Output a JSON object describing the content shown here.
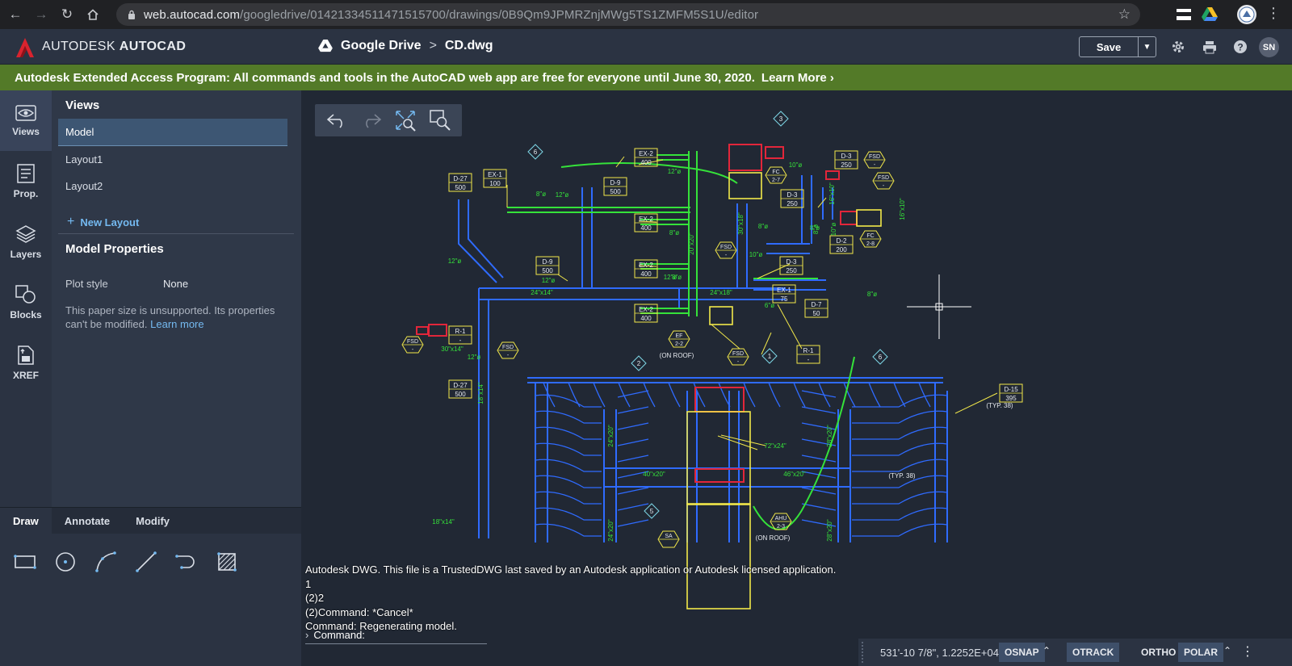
{
  "browser": {
    "url_host": "web.autocad.com",
    "url_path": "/googledrive/01421334511471515700/drawings/0B9Qm9JPMRZnjMWg5TS1ZMFM5S1U/editor"
  },
  "header": {
    "brand_light": "AUTODESK",
    "brand_bold": "AUTOCAD",
    "crumb_root": "Google Drive",
    "crumb_sep": ">",
    "crumb_file": "CD.dwg",
    "save_label": "Save",
    "avatar_initials": "SN"
  },
  "banner": {
    "text": "Autodesk Extended Access Program: All commands and tools in the AutoCAD web app are free for everyone until June 30, 2020.",
    "link": "Learn More ›"
  },
  "rail": {
    "items": [
      {
        "label": "Views",
        "icon": "eye-icon"
      },
      {
        "label": "Prop.",
        "icon": "properties-icon"
      },
      {
        "label": "Layers",
        "icon": "layers-icon"
      },
      {
        "label": "Blocks",
        "icon": "blocks-icon"
      },
      {
        "label": "XREF",
        "icon": "xref-icon"
      }
    ]
  },
  "panel": {
    "views_heading": "Views",
    "views": [
      "Model",
      "Layout1",
      "Layout2"
    ],
    "new_layout": "New Layout",
    "props_heading": "Model Properties",
    "plot_style_label": "Plot style",
    "plot_style_value": "None",
    "note": "This paper size is unsupported. Its properties can't be modified.",
    "note_link": "Learn more"
  },
  "tools": {
    "tabs": [
      "Draw",
      "Annotate",
      "Modify"
    ],
    "selected_tab": "Draw",
    "draw_tools": [
      "rectangle-tool",
      "circle-tool",
      "arc-tool",
      "line-tool",
      "polyline-tool",
      "hatch-tool"
    ]
  },
  "canvas_toolbar": [
    "undo",
    "redo",
    "zoom-extents",
    "zoom-window"
  ],
  "command": {
    "history": [
      "Autodesk DWG.  This file is a TrustedDWG last saved by an Autodesk application or Autodesk licensed application.",
      "1",
      "(2)2",
      "(2)Command: *Cancel*",
      "Command: Regenerating model."
    ],
    "prompt": "Command:"
  },
  "status": {
    "coordinates": "531'-10 7/8\", 1.2252E+04",
    "osnap": "OSNAP",
    "otrack": "OTRACK",
    "ortho": "ORTHO",
    "polar": "POLAR"
  },
  "drawing": {
    "tags": [
      {
        "a": "EX-2",
        "b": "400"
      },
      {
        "a": "D-27",
        "b": "500"
      },
      {
        "a": "EX-1",
        "b": "100"
      },
      {
        "a": "D-9",
        "b": "500"
      },
      {
        "a": "EX-2",
        "b": "400"
      },
      {
        "a": "D-3",
        "b": "250"
      },
      {
        "a": "D-3",
        "b": "250"
      },
      {
        "a": "EX-2",
        "b": "400"
      },
      {
        "a": "D-9",
        "b": "500"
      },
      {
        "a": "D-2",
        "b": "200"
      },
      {
        "a": "D-3",
        "b": "250"
      },
      {
        "a": "EX-1",
        "b": "75"
      },
      {
        "a": "D-7",
        "b": "50"
      },
      {
        "a": "EX-2",
        "b": "400"
      },
      {
        "a": "R-1",
        "b": "-"
      },
      {
        "a": "R-1",
        "b": "-"
      },
      {
        "a": "D-27",
        "b": "500"
      },
      {
        "a": "D-15",
        "b": "395"
      }
    ],
    "hexes": [
      {
        "a": "FSD",
        "b": "-"
      },
      {
        "a": "FSD",
        "b": "-"
      },
      {
        "a": "FC",
        "b": "2-7"
      },
      {
        "a": "FC",
        "b": "2-8"
      },
      {
        "a": "FSD",
        "b": "-"
      },
      {
        "a": "FSD",
        "b": "-"
      },
      {
        "a": "FSD",
        "b": "-"
      },
      {
        "a": "FSD",
        "b": "-"
      },
      {
        "a": "EF",
        "b": "2-2"
      },
      {
        "a": "AHU",
        "b": "2-3"
      },
      {
        "a": "SA",
        "b": ""
      }
    ],
    "callouts": [
      "3",
      "6",
      "1",
      "6",
      "2",
      "5"
    ],
    "notes": [
      "(ON ROOF)",
      "(ON ROOF)",
      "(TYP. 38)",
      "(TYP. 38)"
    ],
    "dims": [
      "12\"ø",
      "8\"ø",
      "12\"ø",
      "8\"ø",
      "12\"ø",
      "12\"ø",
      "8\"ø",
      "10\"ø",
      "8\"ø",
      "10\"ø",
      "8\"ø",
      "6\"ø",
      "8\"ø",
      "12\"ø",
      "12\"ø",
      "24\"x14\"",
      "24\"x18\"",
      "20\"x20\"",
      "30\"x18\"",
      "16\"x10\"",
      "16\"x10\"",
      "10\"ø",
      "8\"ø",
      "30\"x14\"",
      "18\"x14\"",
      "24\"x20\"",
      "28\"x20\"",
      "72\"x24\"",
      "40\"x20\"",
      "46\"x20\"",
      "18\"x14\"",
      "24\"x20\"",
      "28\"x20\""
    ]
  },
  "colors": {
    "duct_blue": "#2f6bff",
    "accent_green": "#35e23a",
    "tag_yellow": "#f2e84a",
    "banner_green": "#537a28",
    "header_bg": "#2b3342",
    "canvas_bg": "#212834",
    "equipment_red": "#e2263a"
  }
}
